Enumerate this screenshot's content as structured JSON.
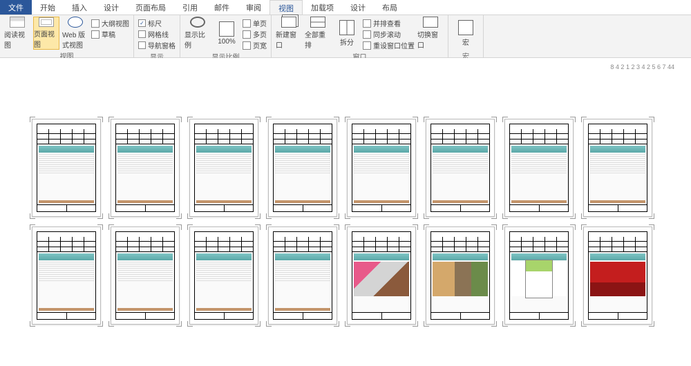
{
  "tabs": {
    "file": "文件",
    "home": "开始",
    "insert": "插入",
    "design": "设计",
    "layout": "页面布局",
    "references": "引用",
    "mailings": "邮件",
    "review": "审阅",
    "view": "视图",
    "addins": "加载项",
    "design2": "设计",
    "layout2": "布局"
  },
  "ribbon": {
    "views": {
      "read": "阅读视图",
      "print": "页面视图",
      "web": "Web 版式视图",
      "outline": "大纲视图",
      "draft": "草稿",
      "group": "视图"
    },
    "show": {
      "ruler": "标尺",
      "gridlines": "网格线",
      "navpane": "导航窗格",
      "group": "显示"
    },
    "zoom": {
      "zoom": "显示比例",
      "hundred": "100%",
      "onepage": "单页",
      "multipage": "多页",
      "pagewidth": "页宽",
      "group": "显示比例"
    },
    "window": {
      "newwin": "新建窗口",
      "arrange": "全部重排",
      "split": "拆分",
      "sidebyside": "并排查看",
      "syncscroll": "同步滚动",
      "resetpos": "重设窗口位置",
      "switchwin": "切换窗口",
      "group": "窗口"
    },
    "macros": {
      "macro": "宏",
      "group": "宏"
    }
  },
  "ruler_text": "8 4 2 1 2 3 4 2 5 6 7 44",
  "checked": {
    "ruler": true,
    "gridlines": false,
    "navpane": false
  }
}
